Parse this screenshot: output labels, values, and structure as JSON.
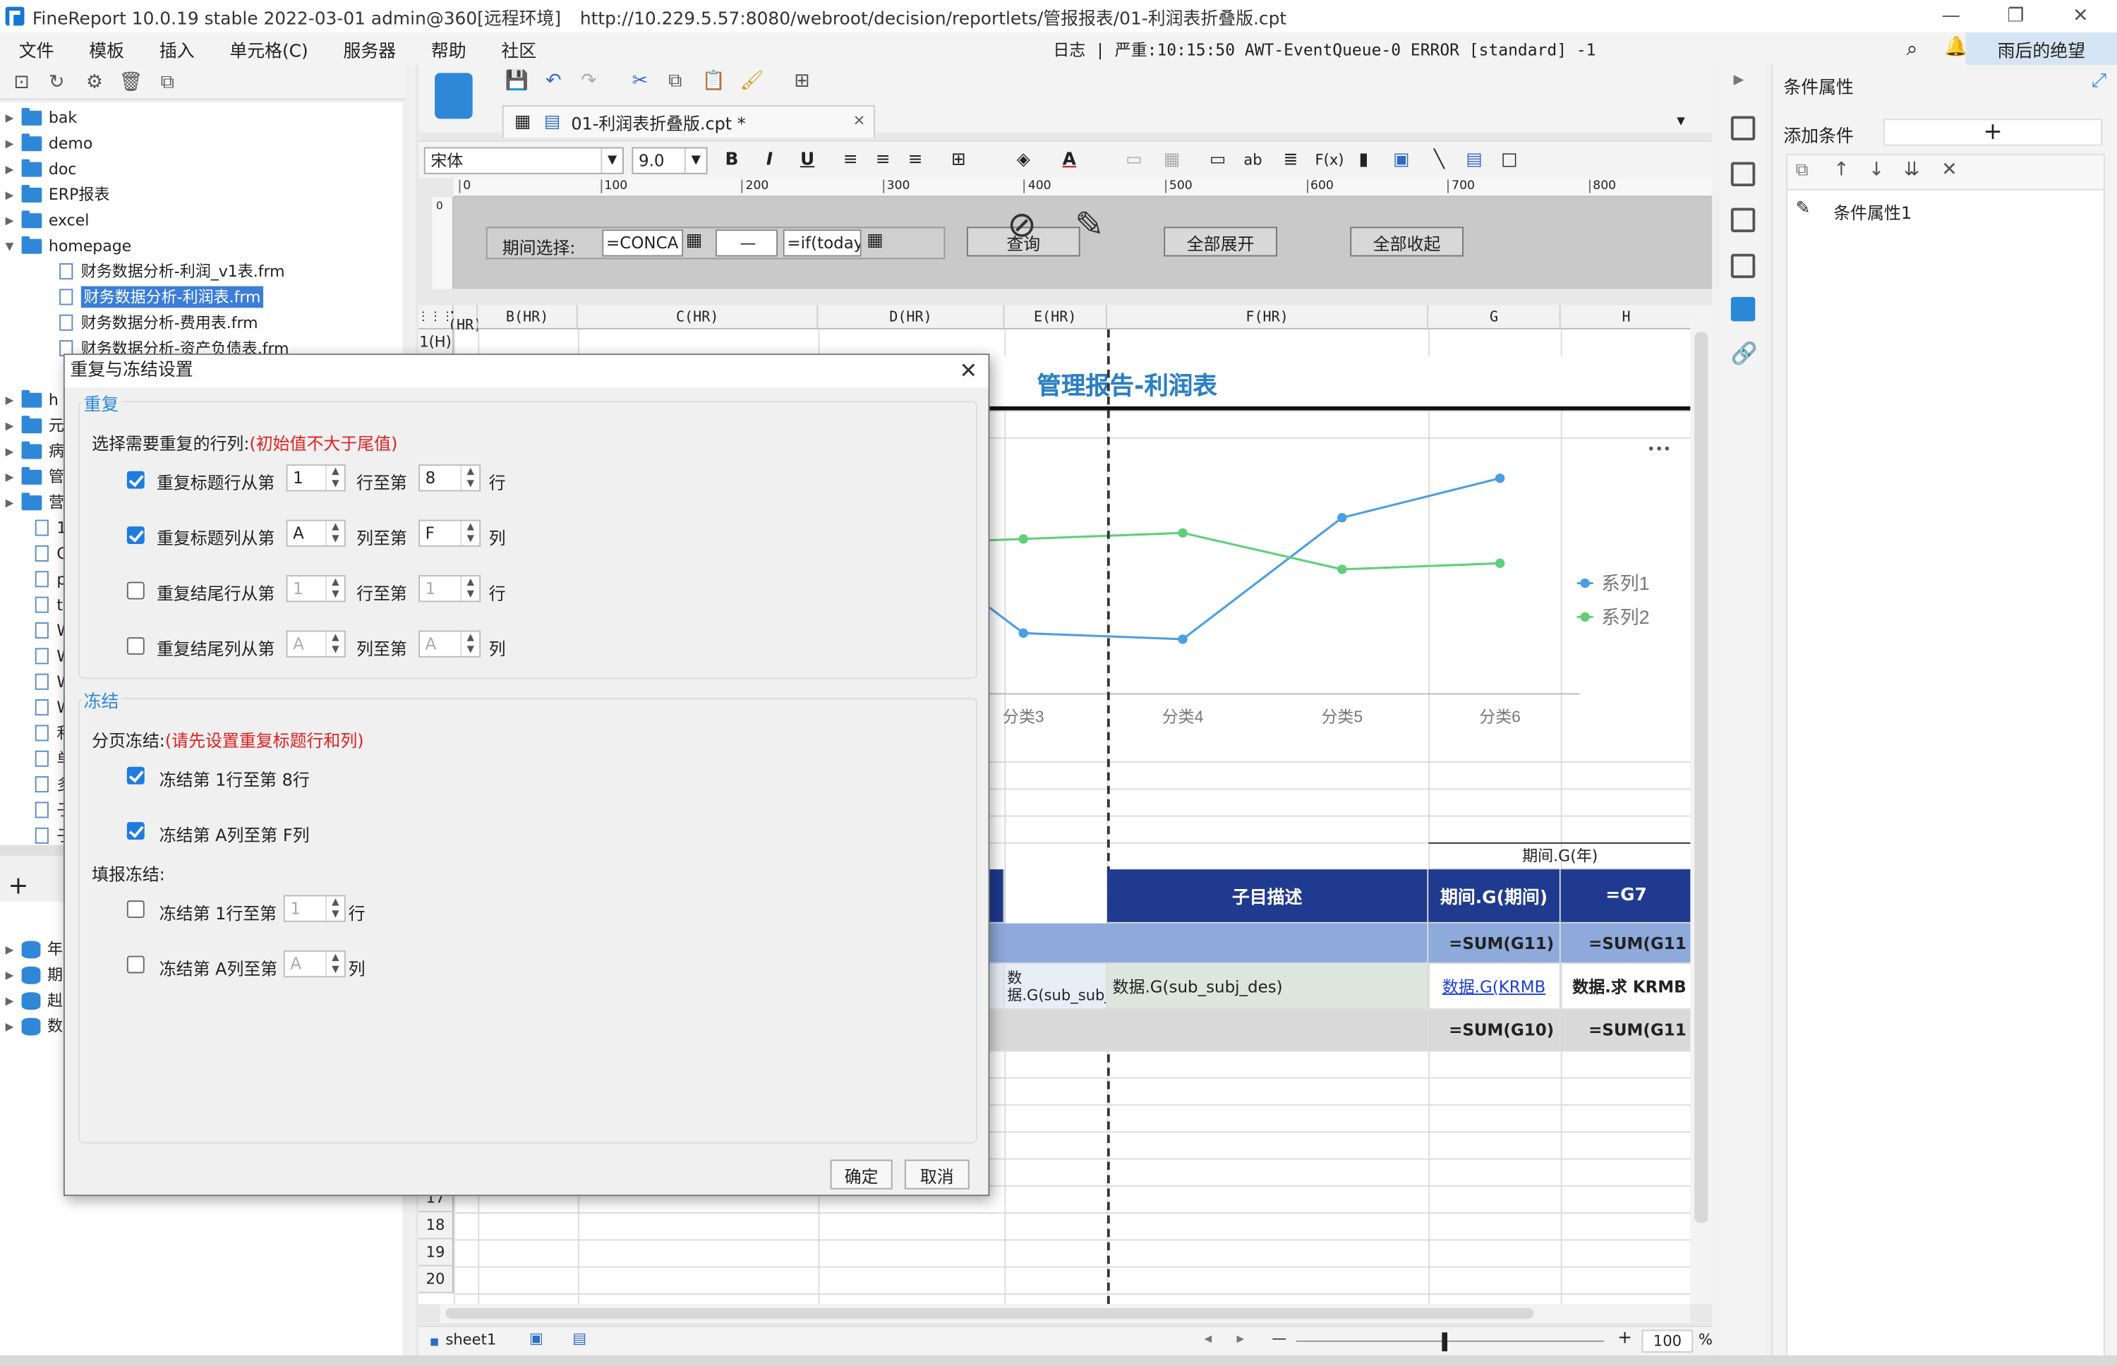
{
  "window": {
    "title": "FineReport 10.0.19 stable 2022-03-01 admin@360[远程环境]",
    "url": "http://10.229.5.57:8080/webroot/decision/reportlets/管报报表/01-利润表折叠版.cpt",
    "minimize": "—",
    "restore": "❐",
    "close": "✕"
  },
  "menu": {
    "items": [
      "文件",
      "模板",
      "插入",
      "单元格(C)",
      "服务器",
      "帮助",
      "社区"
    ],
    "log": "日志 | 严重:10:15:50 AWT-EventQueue-0 ERROR [standard] -1",
    "user": "雨后的绝望"
  },
  "tree": {
    "folders": [
      {
        "name": "bak",
        "expanded": false
      },
      {
        "name": "demo",
        "expanded": false
      },
      {
        "name": "doc",
        "expanded": false
      },
      {
        "name": "ERP报表",
        "expanded": false
      },
      {
        "name": "excel",
        "expanded": false
      },
      {
        "name": "homepage",
        "expanded": true
      }
    ],
    "files": [
      "财务数据分析-利润_v1表.frm",
      "财务数据分析-利润表.frm",
      "财务数据分析-费用表.frm",
      "财务数据分析-资产负债表.frm"
    ],
    "selected_file_index": 1,
    "partial_left": [
      "h",
      "元",
      "病",
      "管",
      "营",
      "1",
      "G",
      "p",
      "t",
      "W",
      "W",
      "W",
      "W",
      "利",
      "单",
      "多",
      "子",
      "子"
    ],
    "datasets_partial": [
      "年",
      "期",
      "赳",
      "数"
    ],
    "add_label": "+"
  },
  "editor": {
    "tab_title": "01-利润表折叠版.cpt *",
    "font_name": "宋体",
    "font_size": "9.0",
    "bold": "B",
    "italic": "I",
    "underline": "U",
    "ruler_ticks": [
      "0",
      "100",
      "200",
      "300",
      "400",
      "500",
      "600",
      "700",
      "800"
    ],
    "param": {
      "label": "期间选择:",
      "input1": "=CONCA",
      "dash": "—",
      "input2": "=if(today(",
      "query": "查询",
      "expand_all": "全部展开",
      "collapse_all": "全部收起"
    },
    "columns": [
      ".(HR)",
      "B(HR)",
      "C(HR)",
      "D(HR)",
      "E(HR)",
      "F(HR)",
      "G",
      "H"
    ],
    "rows": [
      "1(H)",
      "17",
      "18",
      "19",
      "20"
    ],
    "report_title": "管理报告-利润表",
    "header_cells": {
      "period_year": "期间.G(年)",
      "sub_desc": "子目描述",
      "period": "期间.G(期间)",
      "g7": "=G7"
    },
    "data_cells": {
      "sum_g11_a": "=SUM(G11)",
      "sum_g11_b": "=SUM(G11",
      "subjects": "数据.G(sub_subjects)",
      "sub_subj_des": "数据.G(sub_subj_des)",
      "krmb_link": "数据.G(KRMB",
      "krmb_bold": "数据.求 KRMB",
      "sum_g10": "=SUM(G10)",
      "sum_g11_c": "=SUM(G11"
    },
    "sheet": "sheet1",
    "zoom": "100",
    "zoom_unit": "%",
    "zoom_minus": "—",
    "zoom_plus": "+"
  },
  "chart_data": {
    "type": "line",
    "categories": [
      "分类3",
      "分类4",
      "分类5",
      "分类6"
    ],
    "series": [
      {
        "name": "系列1",
        "color": "#4a9ee3",
        "values": [
          2.0,
          1.8,
          5.8,
          7.1
        ]
      },
      {
        "name": "系列2",
        "color": "#5fcf7a",
        "values": [
          5.1,
          5.3,
          4.1,
          4.3
        ]
      }
    ],
    "ylim": [
      0,
      8
    ],
    "legend": "right",
    "more": "•••"
  },
  "right_panel": {
    "title": "条件属性",
    "add_condition": "添加条件",
    "add_btn": "+",
    "item": "条件属性1"
  },
  "dialog": {
    "title": "重复与冻结设置",
    "repeat_section": "重复",
    "repeat_hint_prefix": "选择需要重复的行列:",
    "repeat_hint_red": "(初始值不大于尾值)",
    "rows": [
      {
        "label": "重复标题行从第",
        "checked": true,
        "from": "1",
        "mid": "行至第",
        "to": "8",
        "unit": "行",
        "enabled": true
      },
      {
        "label": "重复标题列从第",
        "checked": true,
        "from": "A",
        "mid": "列至第",
        "to": "F",
        "unit": "列",
        "enabled": true
      },
      {
        "label": "重复结尾行从第",
        "checked": false,
        "from": "1",
        "mid": "行至第",
        "to": "1",
        "unit": "行",
        "enabled": false
      },
      {
        "label": "重复结尾列从第",
        "checked": false,
        "from": "A",
        "mid": "列至第",
        "to": "A",
        "unit": "列",
        "enabled": false
      }
    ],
    "freeze_section": "冻结",
    "page_freeze_prefix": "分页冻结:",
    "page_freeze_red": "(请先设置重复标题行和列)",
    "freeze_rows_label": "冻结第 1行至第 8行",
    "freeze_cols_label": "冻结第 A列至第 F列",
    "fill_freeze": "填报冻结:",
    "fill_row_label": "冻结第 1行至第",
    "fill_row_value": "1",
    "fill_row_unit": "行",
    "fill_col_label": "冻结第 A列至第",
    "fill_col_value": "A",
    "fill_col_unit": "列",
    "ok": "确定",
    "cancel": "取消"
  }
}
